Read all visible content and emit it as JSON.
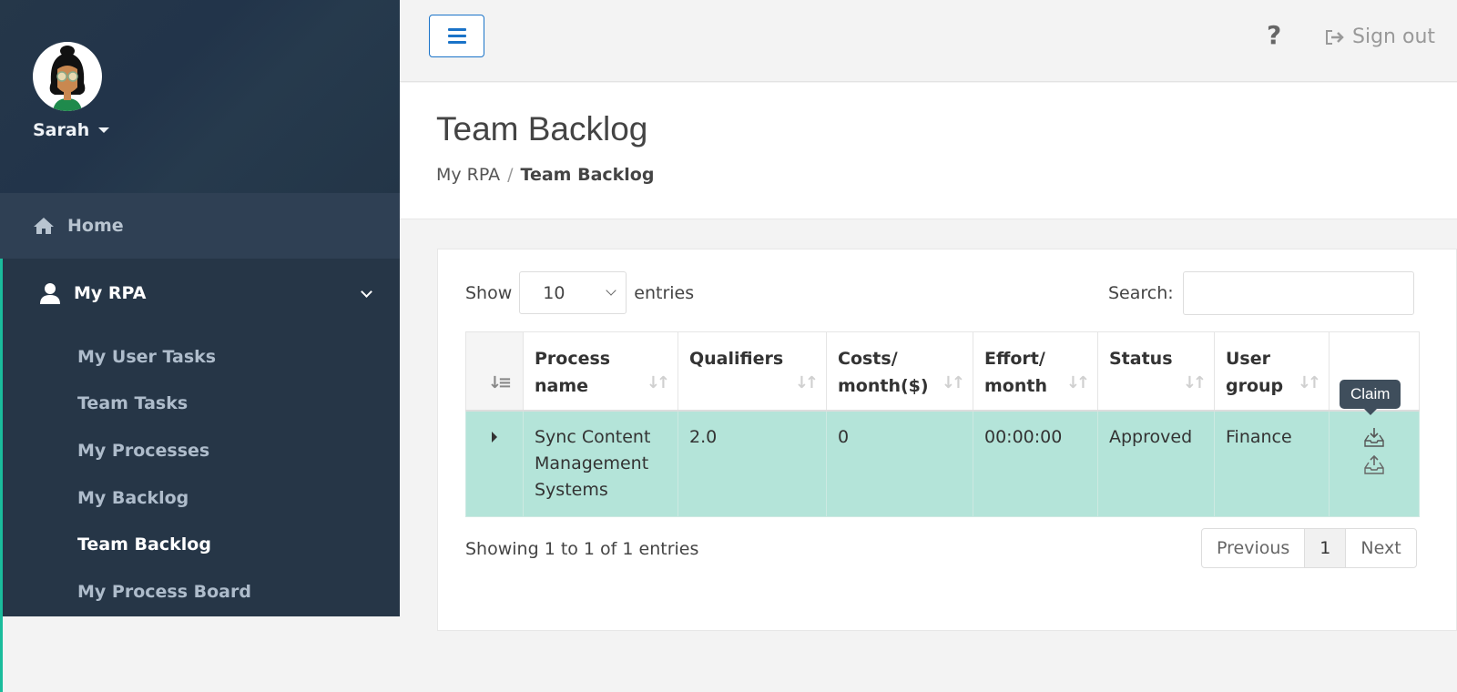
{
  "user": {
    "name": "Sarah"
  },
  "sidebar": {
    "home": "Home",
    "section": "My RPA",
    "items": [
      {
        "label": "My User Tasks"
      },
      {
        "label": "Team Tasks"
      },
      {
        "label": "My Processes"
      },
      {
        "label": "My Backlog"
      },
      {
        "label": "Team Backlog",
        "active": true
      },
      {
        "label": "My Process Board"
      }
    ]
  },
  "topbar": {
    "help": "?",
    "signout": "Sign out"
  },
  "page": {
    "title": "Team Backlog",
    "breadcrumb": [
      "My RPA",
      "/",
      "Team Backlog"
    ]
  },
  "controls": {
    "show": "Show",
    "length": "10",
    "entries": "entries",
    "search_label": "Search:",
    "search_value": ""
  },
  "table": {
    "columns": [
      "Process name",
      "Qualifiers",
      "Costs/ month($)",
      "Effort/ month",
      "Status",
      "User group"
    ],
    "rows": [
      {
        "process": "Sync Content Management Systems",
        "qualifiers": "2.0",
        "costs": "0",
        "effort": "00:00:00",
        "status": "Approved",
        "group": "Finance"
      }
    ]
  },
  "tooltip": "Claim",
  "footer": {
    "info": "Showing 1 to 1 of 1 entries",
    "previous": "Previous",
    "page": "1",
    "next": "Next"
  },
  "colors": {
    "sidebar": "#263647",
    "accent": "#1abc9c",
    "row_highlight": "#b4e4d9",
    "primary": "#1a73c8"
  }
}
